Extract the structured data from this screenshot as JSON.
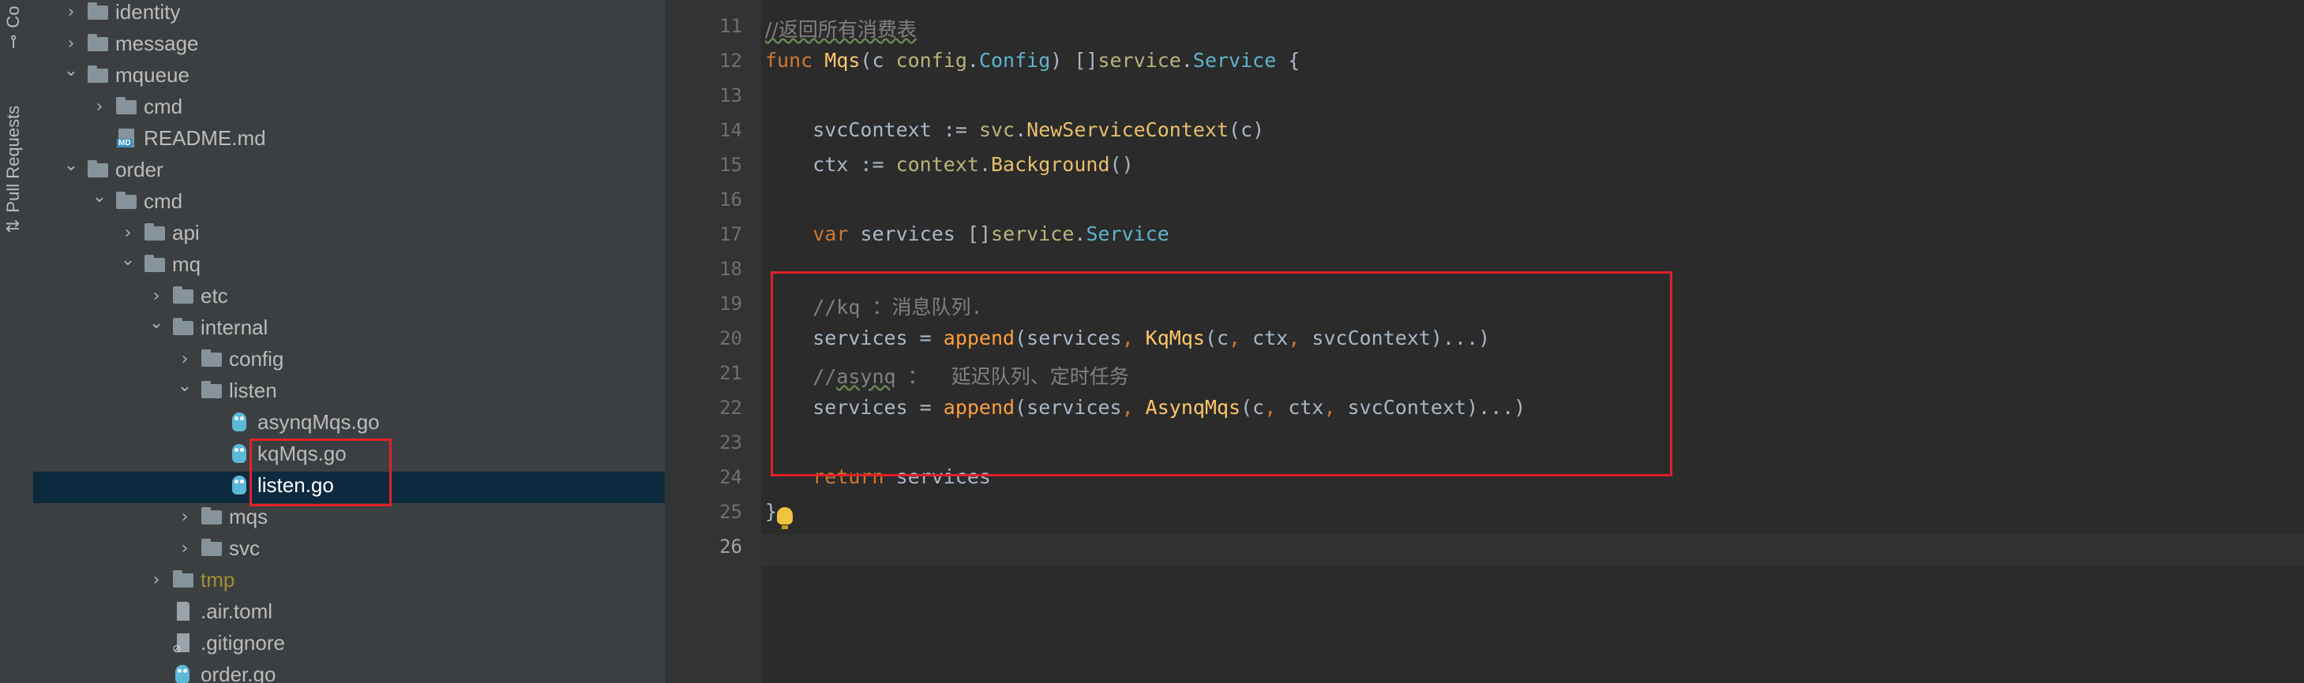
{
  "toolwindow_tabs": [
    "Co",
    "Pull Requests"
  ],
  "tree": [
    {
      "name": "identity",
      "kind": "folder",
      "level": 2,
      "expanded": false
    },
    {
      "name": "message",
      "kind": "folder",
      "level": 2,
      "expanded": false
    },
    {
      "name": "mqueue",
      "kind": "folder",
      "level": 2,
      "expanded": true
    },
    {
      "name": "cmd",
      "kind": "folder",
      "level": 3,
      "expanded": false
    },
    {
      "name": "README.md",
      "kind": "md",
      "level": 3
    },
    {
      "name": "order",
      "kind": "folder",
      "level": 2,
      "expanded": true
    },
    {
      "name": "cmd",
      "kind": "folder",
      "level": 3,
      "expanded": true
    },
    {
      "name": "api",
      "kind": "folder",
      "level": 4,
      "expanded": false
    },
    {
      "name": "mq",
      "kind": "folder",
      "level": 4,
      "expanded": true
    },
    {
      "name": "etc",
      "kind": "folder",
      "level": 5,
      "expanded": false
    },
    {
      "name": "internal",
      "kind": "folder",
      "level": 5,
      "expanded": true
    },
    {
      "name": "config",
      "kind": "folder",
      "level": 6,
      "expanded": false
    },
    {
      "name": "listen",
      "kind": "folder",
      "level": 6,
      "expanded": true
    },
    {
      "name": "asynqMqs.go",
      "kind": "go",
      "level": 7
    },
    {
      "name": "kqMqs.go",
      "kind": "go",
      "level": 7
    },
    {
      "name": "listen.go",
      "kind": "go",
      "level": 7,
      "selected": true
    },
    {
      "name": "mqs",
      "kind": "folder",
      "level": 6,
      "expanded": false
    },
    {
      "name": "svc",
      "kind": "folder",
      "level": 6,
      "expanded": false
    },
    {
      "name": "tmp",
      "kind": "folder",
      "level": 5,
      "expanded": false,
      "excluded": true
    },
    {
      "name": ".air.toml",
      "kind": "text",
      "level": 5
    },
    {
      "name": ".gitignore",
      "kind": "git",
      "level": 5
    },
    {
      "name": "order.go",
      "kind": "go",
      "level": 5
    }
  ],
  "editor": {
    "line_numbers": [
      "11",
      "12",
      "13",
      "14",
      "15",
      "16",
      "17",
      "18",
      "19",
      "20",
      "21",
      "22",
      "23",
      "24",
      "25",
      "26"
    ],
    "current_line": "26",
    "lines": [
      [
        {
          "t": "//返回所有消费表",
          "c": "cmt ul cjk"
        }
      ],
      [
        {
          "t": "func ",
          "c": "kw"
        },
        {
          "t": "Mqs",
          "c": "fn"
        },
        {
          "t": "(c "
        },
        {
          "t": "config",
          "c": "pk"
        },
        {
          "t": "."
        },
        {
          "t": "Config",
          "c": "ty"
        },
        {
          "t": ") []"
        },
        {
          "t": "service",
          "c": "pk"
        },
        {
          "t": "."
        },
        {
          "t": "Service",
          "c": "ty"
        },
        {
          "t": " {"
        }
      ],
      [],
      [
        {
          "t": "    svcContext := "
        },
        {
          "t": "svc",
          "c": "pk"
        },
        {
          "t": "."
        },
        {
          "t": "NewServiceContext",
          "c": "mt"
        },
        {
          "t": "(c)"
        }
      ],
      [
        {
          "t": "    ctx := "
        },
        {
          "t": "context",
          "c": "pk"
        },
        {
          "t": "."
        },
        {
          "t": "Background",
          "c": "mt"
        },
        {
          "t": "()"
        }
      ],
      [],
      [
        {
          "t": "    "
        },
        {
          "t": "var ",
          "c": "kw"
        },
        {
          "t": "services []"
        },
        {
          "t": "service",
          "c": "pk"
        },
        {
          "t": "."
        },
        {
          "t": "Service",
          "c": "ty"
        }
      ],
      [],
      [
        {
          "t": "    //kq ：消息队列.",
          "c": "cmt"
        }
      ],
      [
        {
          "t": "    services = "
        },
        {
          "t": "append",
          "c": "bi"
        },
        {
          "t": "(services"
        },
        {
          "t": ", ",
          "c": "kw"
        },
        {
          "t": "KqMqs",
          "c": "fn"
        },
        {
          "t": "(c"
        },
        {
          "t": ", ",
          "c": "kw"
        },
        {
          "t": "ctx"
        },
        {
          "t": ", ",
          "c": "kw"
        },
        {
          "t": "svcContext)...)"
        }
      ],
      [
        {
          "t": "    //",
          "c": "cmt"
        },
        {
          "t": "asynq",
          "c": "cmt ul"
        },
        {
          "t": " ：  延迟队列、定时任务",
          "c": "cmt"
        }
      ],
      [
        {
          "t": "    services = "
        },
        {
          "t": "append",
          "c": "bi"
        },
        {
          "t": "(services"
        },
        {
          "t": ", ",
          "c": "kw"
        },
        {
          "t": "AsynqMqs",
          "c": "fn"
        },
        {
          "t": "(c"
        },
        {
          "t": ", ",
          "c": "kw"
        },
        {
          "t": "ctx"
        },
        {
          "t": ", ",
          "c": "kw"
        },
        {
          "t": "svcContext)...)"
        }
      ],
      [],
      [
        {
          "t": "    "
        },
        {
          "t": "return ",
          "c": "kw"
        },
        {
          "t": "services"
        }
      ],
      [
        {
          "t": "}"
        }
      ],
      []
    ]
  }
}
